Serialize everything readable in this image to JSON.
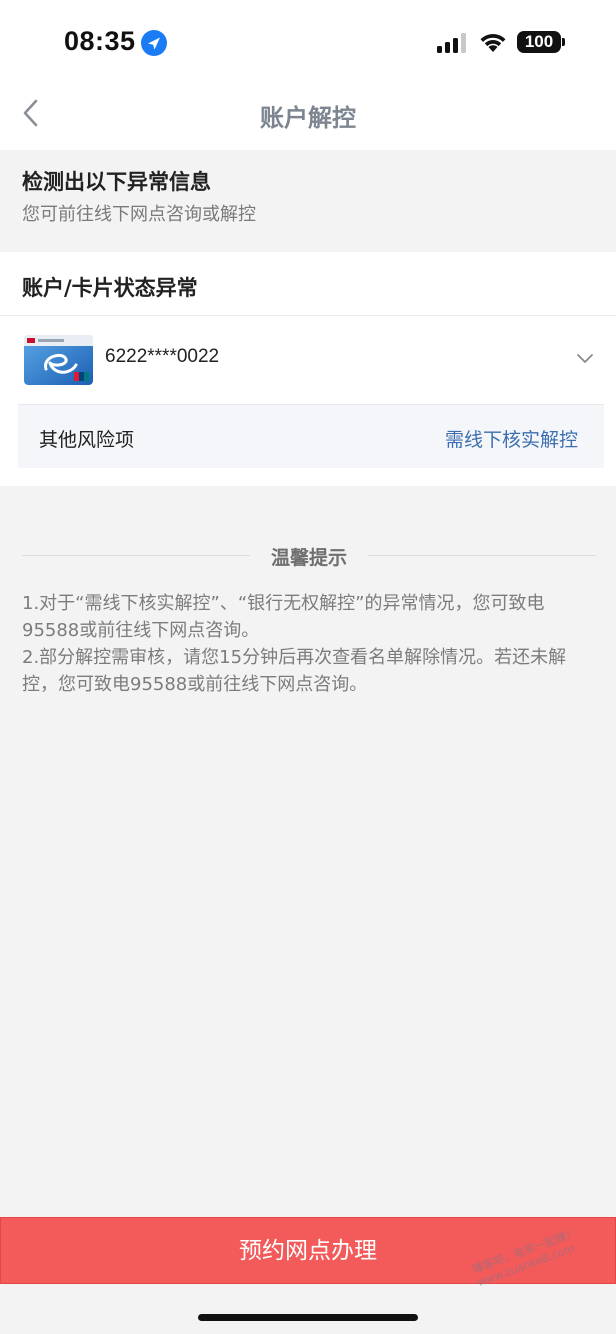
{
  "status_bar": {
    "time": "08:35",
    "battery": "100"
  },
  "nav": {
    "title": "账户解控"
  },
  "alert": {
    "title": "检测出以下异常信息",
    "subtitle": "您可前往线下网点咨询或解控"
  },
  "section": {
    "title": "账户/卡片状态异常",
    "card_number": "6222****0022",
    "risk_label": "其他风险项",
    "risk_action": "需线下核实解控"
  },
  "tips": {
    "title": "温馨提示",
    "line1": "1.对于“需线下核实解控”、“银行无权解控”的异常情况，您可致电95588或前往线下网点咨询。",
    "line2": "2.部分解控需审核，请您15分钟后再次查看名单解除情况。若还未解控，您可致电95588或前往线下网点咨询。"
  },
  "button": {
    "label": "预约网点办理"
  },
  "watermark": "赚客吧，有奖一起赚！ www.zuanke8.com",
  "colors": {
    "accent_red": "#f35a5a",
    "link_blue": "#3d6fb0"
  }
}
